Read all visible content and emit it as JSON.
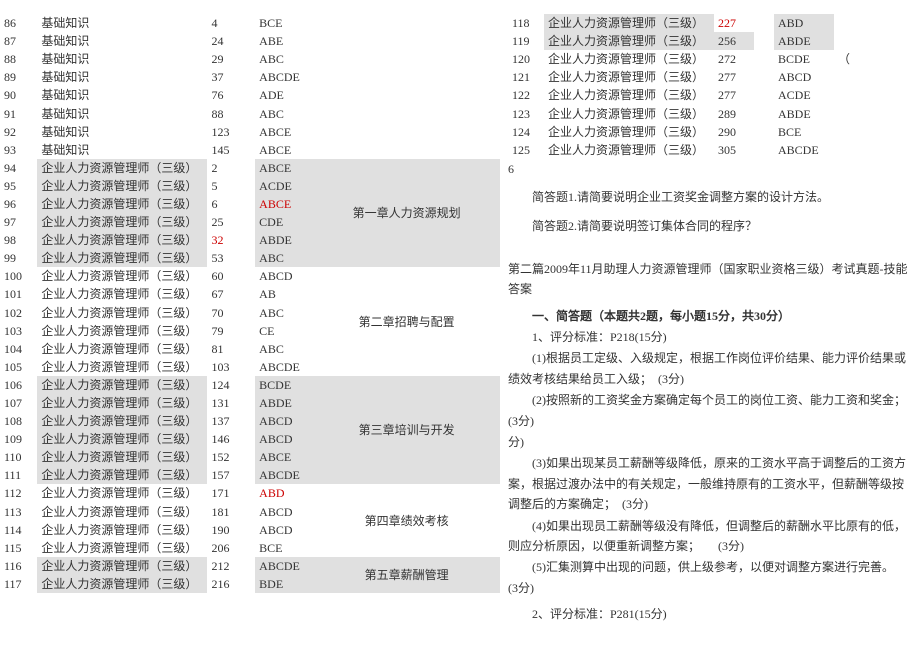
{
  "left_rows": [
    {
      "n": "86",
      "sub": "基础知识",
      "pg": "4",
      "ans": "BCE",
      "sec": "",
      "sub_hl": false,
      "pg_hl": false,
      "ans_hl": false,
      "sec_hl": false,
      "pg_red": false,
      "ans_red": false
    },
    {
      "n": "87",
      "sub": "基础知识",
      "pg": "24",
      "ans": "ABE",
      "sec": "",
      "sub_hl": false,
      "pg_hl": false,
      "ans_hl": false,
      "sec_hl": false,
      "pg_red": false,
      "ans_red": false
    },
    {
      "n": "88",
      "sub": "基础知识",
      "pg": "29",
      "ans": "ABC",
      "sec": "",
      "sub_hl": false,
      "pg_hl": false,
      "ans_hl": false,
      "sec_hl": false,
      "pg_red": false,
      "ans_red": false
    },
    {
      "n": "89",
      "sub": "基础知识",
      "pg": "37",
      "ans": "ABCDE",
      "sec": "",
      "sub_hl": false,
      "pg_hl": false,
      "ans_hl": false,
      "sec_hl": false,
      "pg_red": false,
      "ans_red": false
    },
    {
      "n": "90",
      "sub": "基础知识",
      "pg": "76",
      "ans": "ADE",
      "sec": "",
      "sub_hl": false,
      "pg_hl": false,
      "ans_hl": false,
      "sec_hl": false,
      "pg_red": false,
      "ans_red": false
    },
    {
      "n": "91",
      "sub": "基础知识",
      "pg": "88",
      "ans": "ABC",
      "sec": "",
      "sub_hl": false,
      "pg_hl": false,
      "ans_hl": false,
      "sec_hl": false,
      "pg_red": false,
      "ans_red": false
    },
    {
      "n": "92",
      "sub": "基础知识",
      "pg": "123",
      "ans": "ABCE",
      "sec": "",
      "sub_hl": false,
      "pg_hl": false,
      "ans_hl": false,
      "sec_hl": false,
      "pg_red": false,
      "ans_red": false
    },
    {
      "n": "93",
      "sub": "基础知识",
      "pg": "145",
      "ans": "ABCE",
      "sec": "",
      "sub_hl": false,
      "pg_hl": false,
      "ans_hl": false,
      "sec_hl": false,
      "pg_red": false,
      "ans_red": false
    },
    {
      "n": "94",
      "sub": "企业人力资源管理师（三级）",
      "pg": "2",
      "ans": "ABCE",
      "sec": "",
      "sub_hl": true,
      "pg_hl": false,
      "ans_hl": true,
      "sec_hl": true,
      "pg_red": false,
      "ans_red": false
    },
    {
      "n": "95",
      "sub": "企业人力资源管理师（三级）",
      "pg": "5",
      "ans": "ACDE",
      "sec": "",
      "sub_hl": true,
      "pg_hl": false,
      "ans_hl": true,
      "sec_hl": true,
      "pg_red": false,
      "ans_red": false
    },
    {
      "n": "96",
      "sub": "企业人力资源管理师（三级）",
      "pg": "6",
      "ans": "ABCE",
      "sec": "第一章人力资源规划",
      "sub_hl": true,
      "pg_hl": false,
      "ans_hl": true,
      "sec_hl": true,
      "pg_red": false,
      "ans_red": true
    },
    {
      "n": "97",
      "sub": "企业人力资源管理师（三级）",
      "pg": "25",
      "ans": "CDE",
      "sec": "",
      "sub_hl": true,
      "pg_hl": false,
      "ans_hl": true,
      "sec_hl": true,
      "pg_red": false,
      "ans_red": false
    },
    {
      "n": "98",
      "sub": "企业人力资源管理师（三级）",
      "pg": "32",
      "ans": "ABDE",
      "sec": "",
      "sub_hl": true,
      "pg_hl": false,
      "ans_hl": true,
      "sec_hl": true,
      "pg_red": true,
      "ans_red": false
    },
    {
      "n": "99",
      "sub": "企业人力资源管理师（三级）",
      "pg": "53",
      "ans": "ABC",
      "sec": "",
      "sub_hl": true,
      "pg_hl": false,
      "ans_hl": true,
      "sec_hl": true,
      "pg_red": false,
      "ans_red": false
    },
    {
      "n": "100",
      "sub": "企业人力资源管理师（三级）",
      "pg": "60",
      "ans": "ABCD",
      "sec": "",
      "sub_hl": false,
      "pg_hl": false,
      "ans_hl": false,
      "sec_hl": false,
      "pg_red": false,
      "ans_red": false
    },
    {
      "n": "101",
      "sub": "企业人力资源管理师（三级）",
      "pg": "67",
      "ans": "AB",
      "sec": "",
      "sub_hl": false,
      "pg_hl": false,
      "ans_hl": false,
      "sec_hl": false,
      "pg_red": false,
      "ans_red": false
    },
    {
      "n": "102",
      "sub": "企业人力资源管理师（三级）",
      "pg": "70",
      "ans": "ABC",
      "sec": "",
      "sub_hl": false,
      "pg_hl": false,
      "ans_hl": false,
      "sec_hl": false,
      "pg_red": false,
      "ans_red": false
    },
    {
      "n": "103",
      "sub": "企业人力资源管理师（三级）",
      "pg": "79",
      "ans": "CE",
      "sec": "第二章招聘与配置",
      "sub_hl": false,
      "pg_hl": false,
      "ans_hl": false,
      "sec_hl": false,
      "pg_red": false,
      "ans_red": false
    },
    {
      "n": "104",
      "sub": "企业人力资源管理师（三级）",
      "pg": "81",
      "ans": "ABC",
      "sec": "",
      "sub_hl": false,
      "pg_hl": false,
      "ans_hl": false,
      "sec_hl": false,
      "pg_red": false,
      "ans_red": false
    },
    {
      "n": "105",
      "sub": "企业人力资源管理师（三级）",
      "pg": "103",
      "ans": "ABCDE",
      "sec": "",
      "sub_hl": false,
      "pg_hl": false,
      "ans_hl": false,
      "sec_hl": false,
      "pg_red": false,
      "ans_red": false
    },
    {
      "n": "106",
      "sub": "企业人力资源管理师（三级）",
      "pg": "124",
      "ans": "BCDE",
      "sec": "",
      "sub_hl": true,
      "pg_hl": false,
      "ans_hl": true,
      "sec_hl": true,
      "pg_red": false,
      "ans_red": false
    },
    {
      "n": "107",
      "sub": "企业人力资源管理师（三级）",
      "pg": "131",
      "ans": "ABDE",
      "sec": "",
      "sub_hl": true,
      "pg_hl": false,
      "ans_hl": true,
      "sec_hl": true,
      "pg_red": false,
      "ans_red": false
    },
    {
      "n": "108",
      "sub": "企业人力资源管理师（三级）",
      "pg": "137",
      "ans": "ABCD",
      "sec": "",
      "sub_hl": true,
      "pg_hl": false,
      "ans_hl": true,
      "sec_hl": true,
      "pg_red": false,
      "ans_red": false
    },
    {
      "n": "109",
      "sub": "企业人力资源管理师（三级）",
      "pg": "146",
      "ans": "ABCD",
      "sec": "第三章培训与开发",
      "sub_hl": true,
      "pg_hl": false,
      "ans_hl": true,
      "sec_hl": true,
      "pg_red": false,
      "ans_red": false
    },
    {
      "n": "110",
      "sub": "企业人力资源管理师（三级）",
      "pg": "152",
      "ans": "ABCE",
      "sec": "",
      "sub_hl": true,
      "pg_hl": false,
      "ans_hl": true,
      "sec_hl": true,
      "pg_red": false,
      "ans_red": false
    },
    {
      "n": "111",
      "sub": "企业人力资源管理师（三级）",
      "pg": "157",
      "ans": "ABCDE",
      "sec": "",
      "sub_hl": true,
      "pg_hl": false,
      "ans_hl": true,
      "sec_hl": true,
      "pg_red": false,
      "ans_red": false
    },
    {
      "n": "112",
      "sub": "企业人力资源管理师（三级）",
      "pg": "171",
      "ans": "ABD",
      "sec": "",
      "sub_hl": false,
      "pg_hl": false,
      "ans_hl": false,
      "sec_hl": false,
      "pg_red": false,
      "ans_red": true
    },
    {
      "n": "113",
      "sub": "企业人力资源管理师（三级）",
      "pg": "181",
      "ans": "ABCD",
      "sec": "",
      "sub_hl": false,
      "pg_hl": false,
      "ans_hl": false,
      "sec_hl": false,
      "pg_red": false,
      "ans_red": false
    },
    {
      "n": "114",
      "sub": "企业人力资源管理师（三级）",
      "pg": "190",
      "ans": "ABCD",
      "sec": "第四章绩效考核",
      "sub_hl": false,
      "pg_hl": false,
      "ans_hl": false,
      "sec_hl": false,
      "pg_red": false,
      "ans_red": false
    },
    {
      "n": "115",
      "sub": "企业人力资源管理师（三级）",
      "pg": "206",
      "ans": "BCE",
      "sec": "",
      "sub_hl": false,
      "pg_hl": false,
      "ans_hl": false,
      "sec_hl": false,
      "pg_red": false,
      "ans_red": false
    },
    {
      "n": "116",
      "sub": "企业人力资源管理师（三级）",
      "pg": "212",
      "ans": "ABCDE",
      "sec": "",
      "sub_hl": true,
      "pg_hl": false,
      "ans_hl": true,
      "sec_hl": true,
      "pg_red": false,
      "ans_red": false
    },
    {
      "n": "117",
      "sub": "企业人力资源管理师（三级）",
      "pg": "216",
      "ans": "BDE",
      "sec": "第五章薪酬管理",
      "sub_hl": true,
      "pg_hl": false,
      "ans_hl": true,
      "sec_hl": true,
      "pg_red": false,
      "ans_red": false
    }
  ],
  "right_rows": [
    {
      "n": "118",
      "sub": "企业人力资源管理师（三级）",
      "pg": "227",
      "ans": "ABD",
      "sub_hl": true,
      "pg_hl": false,
      "ans_hl": true,
      "pg_red": true,
      "ans_red": false,
      "extra": ""
    },
    {
      "n": "119",
      "sub": "企业人力资源管理师（三级）",
      "pg": "256",
      "ans": "ABDE",
      "sub_hl": true,
      "pg_hl": true,
      "ans_hl": true,
      "pg_red": false,
      "ans_red": false,
      "extra": ""
    },
    {
      "n": "120",
      "sub": "企业人力资源管理师（三级）",
      "pg": "272",
      "ans": "BCDE",
      "sub_hl": false,
      "pg_hl": false,
      "ans_hl": false,
      "pg_red": false,
      "ans_red": false,
      "extra": "（"
    },
    {
      "n": "121",
      "sub": "企业人力资源管理师（三级）",
      "pg": "277",
      "ans": "ABCD",
      "sub_hl": false,
      "pg_hl": false,
      "ans_hl": false,
      "pg_red": false,
      "ans_red": false,
      "extra": ""
    },
    {
      "n": "122",
      "sub": "企业人力资源管理师（三级）",
      "pg": "277",
      "ans": "ACDE",
      "sub_hl": false,
      "pg_hl": false,
      "ans_hl": false,
      "pg_red": false,
      "ans_red": false,
      "extra": ""
    },
    {
      "n": "123",
      "sub": "企业人力资源管理师（三级）",
      "pg": "289",
      "ans": "ABDE",
      "sub_hl": false,
      "pg_hl": false,
      "ans_hl": false,
      "pg_red": false,
      "ans_red": false,
      "extra": ""
    },
    {
      "n": "124",
      "sub": "企业人力资源管理师（三级）",
      "pg": "290",
      "ans": "BCE",
      "sub_hl": false,
      "pg_hl": false,
      "ans_hl": false,
      "pg_red": false,
      "ans_red": false,
      "extra": ""
    },
    {
      "n": "125",
      "sub": "企业人力资源管理师（三级）",
      "pg": "305",
      "ans": "ABCDE",
      "sub_hl": false,
      "pg_hl": false,
      "ans_hl": false,
      "pg_red": false,
      "ans_red": false,
      "extra": ""
    }
  ],
  "right_header_six_a": "6",
  "right_header_six_b": "6",
  "q1": "简答题1.请简要说明企业工资奖金调整方案的设计方法。",
  "q2": "简答题2.请简要说明签订集体合同的程序？",
  "essay_title": "第二篇2009年11月助理人力资源管理师（国家职业资格三级）考试真题-技能答案",
  "section_heading": "一、简答题（本题共2题，每小题15分，共30分）",
  "body": {
    "p1": "1、评分标准：P218(15分)",
    "p2": "(1)根据员工定级、入级规定，根据工作岗位评价结果、能力评价结果或绩效考核结果给员工入级；　(3分)",
    "p3": "(2)按照新的工资奖金方案确定每个员工的岗位工资、能力工资和奖金；　　(3分)",
    "p4_a": "分)",
    "p5": "(3)如果出现某员工薪酬等级降低，原来的工资水平高于调整后的工资方案，根据过渡办法中的有关规定，一般维持原有的工资水平，但薪酬等级按调整后的方案确定；　(3分)",
    "p6": "(4)如果出现员工薪酬等级没有降低，但调整后的薪酬水平比原有的低，则应分析原因，以便重新调整方案；　　(3分)",
    "p7": "(5)汇集测算中出现的问题，供上级参考，以便对调整方案进行完善。　　(3分)",
    "p8": "2、评分标准：P281(15分)"
  }
}
